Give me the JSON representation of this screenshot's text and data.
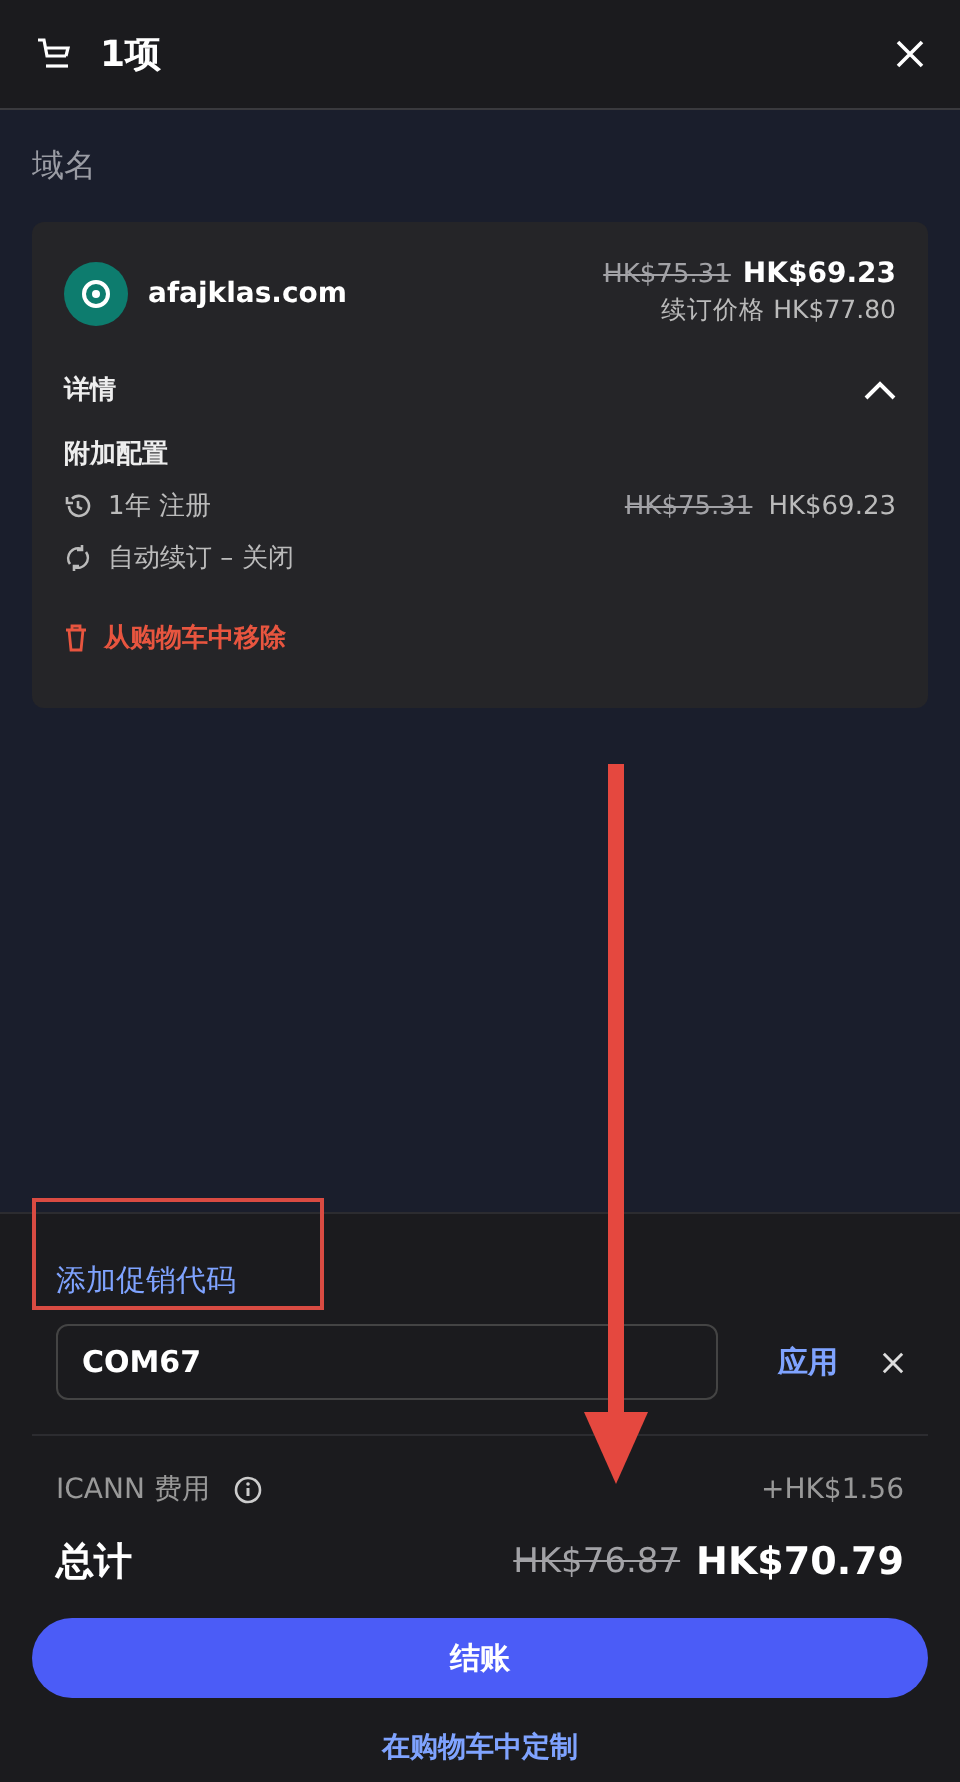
{
  "header": {
    "title": "1项"
  },
  "section_title": "域名",
  "item": {
    "domain": "afajklas.com",
    "old_price": "HK$75.31",
    "price": "HK$69.23",
    "renewal": "续订价格 HK$77.80",
    "details_label": "详情",
    "expanded": true,
    "config_title": "附加配置",
    "options": [
      {
        "kind": "term",
        "label": "1年 注册",
        "old_price": "HK$75.31",
        "price": "HK$69.23"
      },
      {
        "kind": "renew",
        "label": "自动续订 – 关闭"
      }
    ],
    "remove": "从购物车中移除"
  },
  "promo": {
    "link": "添加促销代码",
    "value": "COM67",
    "apply": "应用"
  },
  "fee": {
    "label": "ICANN 费用",
    "amount": "+HK$1.56"
  },
  "total": {
    "label": "总计",
    "old_price": "HK$76.87",
    "price": "HK$70.79"
  },
  "checkout": "结账",
  "customize": "在购物车中定制"
}
